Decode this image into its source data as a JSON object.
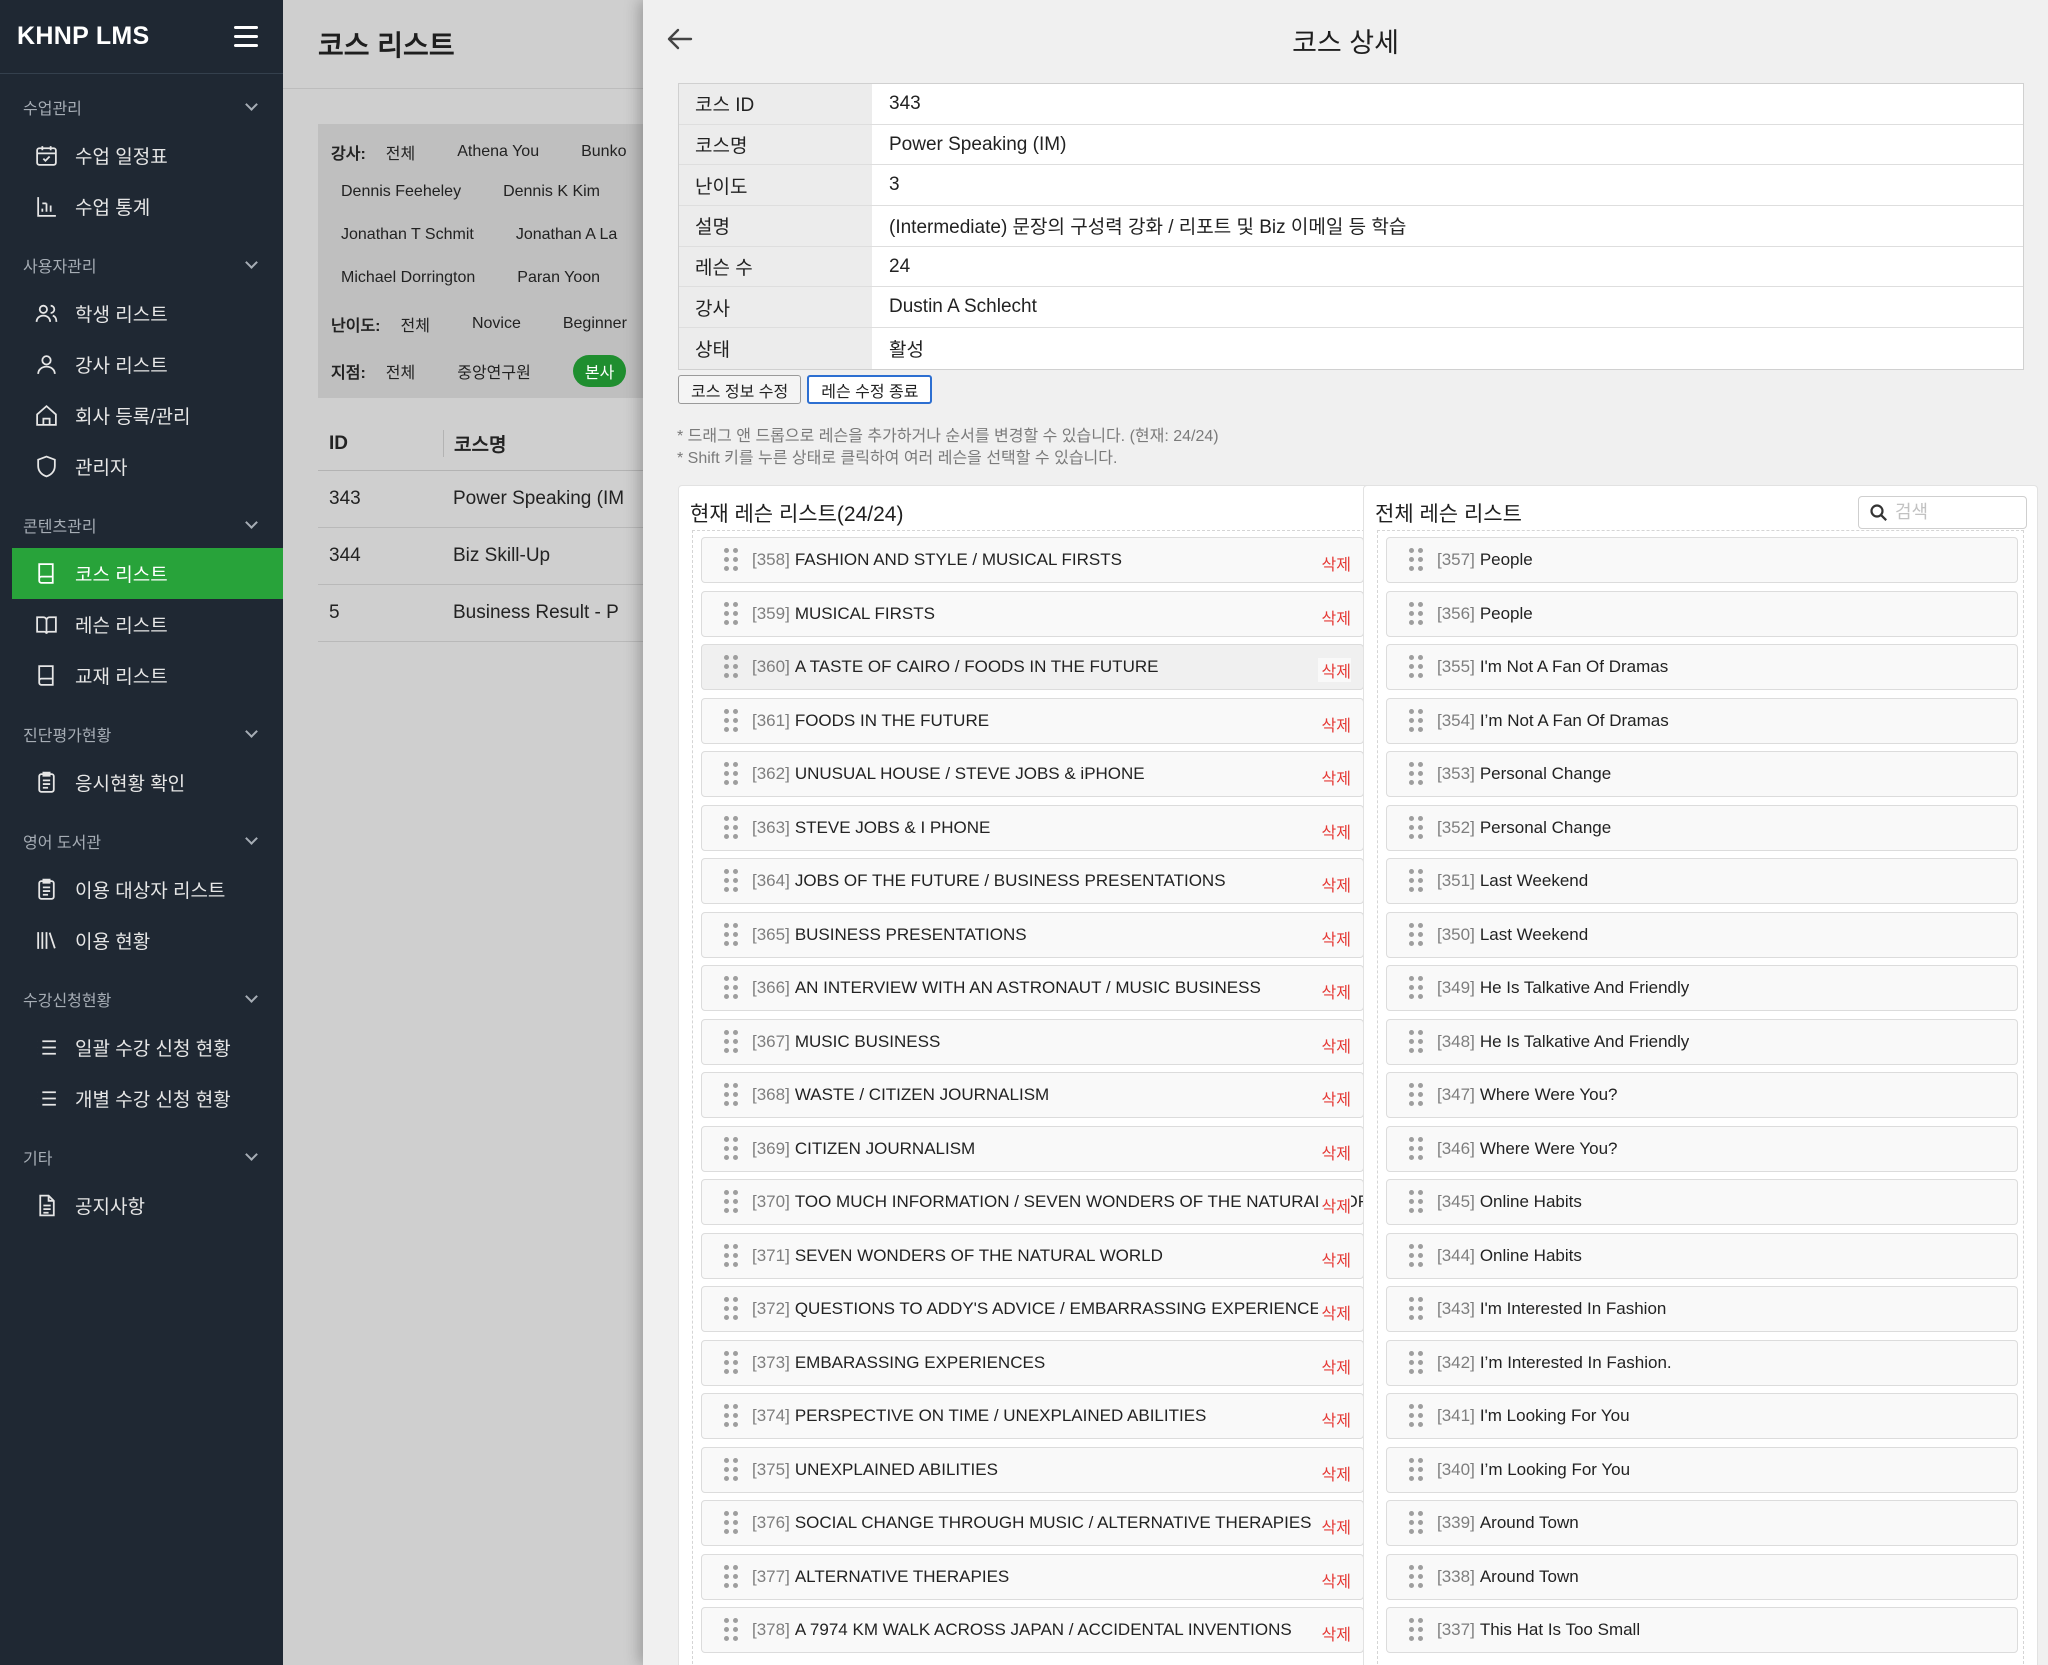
{
  "sidebar": {
    "brand": "KHNP LMS",
    "sections": [
      {
        "title": "수업관리",
        "items": [
          {
            "label": "수업 일정표",
            "icon": "calendar-check-icon"
          },
          {
            "label": "수업 통계",
            "icon": "chart-icon"
          }
        ]
      },
      {
        "title": "사용자관리",
        "items": [
          {
            "label": "학생 리스트",
            "icon": "users-icon"
          },
          {
            "label": "강사 리스트",
            "icon": "user-icon"
          },
          {
            "label": "회사 등록/관리",
            "icon": "home-icon"
          },
          {
            "label": "관리자",
            "icon": "shield-icon"
          }
        ]
      },
      {
        "title": "콘텐츠관리",
        "items": [
          {
            "label": "코스 리스트",
            "icon": "book-icon"
          },
          {
            "label": "레슨 리스트",
            "icon": "book-open-icon"
          },
          {
            "label": "교재 리스트",
            "icon": "book-icon"
          }
        ]
      },
      {
        "title": "진단평가현황",
        "items": [
          {
            "label": "응시현황 확인",
            "icon": "clipboard-icon"
          }
        ]
      },
      {
        "title": "영어 도서관",
        "items": [
          {
            "label": "이용 대상자 리스트",
            "icon": "clipboard-icon"
          },
          {
            "label": "이용 현황",
            "icon": "library-icon"
          }
        ]
      },
      {
        "title": "수강신청현황",
        "items": [
          {
            "label": "일괄 수강 신청 현황",
            "icon": "list-icon"
          },
          {
            "label": "개별 수강 신청 현황",
            "icon": "list-icon"
          }
        ]
      },
      {
        "title": "기타",
        "items": [
          {
            "label": "공지사항",
            "icon": "document-icon"
          }
        ]
      }
    ],
    "active_item": "코스 리스트"
  },
  "background": {
    "title": "코스 리스트",
    "filters": {
      "instructor_label": "강사:",
      "instructors_row1": [
        "전체",
        "Athena You",
        "Bunko"
      ],
      "instructors_row2": [
        "Dennis Feeheley",
        "Dennis K Kim"
      ],
      "instructors_row3": [
        "Jonathan T Schmit",
        "Jonathan A La"
      ],
      "instructors_row4": [
        "Michael Dorrington",
        "Paran Yoon"
      ],
      "level_label": "난이도:",
      "levels": [
        "전체",
        "Novice",
        "Beginner"
      ],
      "branch_label": "지점:",
      "branches": [
        "전체",
        "중앙연구원"
      ],
      "branch_selected": "본사"
    },
    "table": {
      "headers": [
        "ID",
        "코스명"
      ],
      "rows": [
        [
          "343",
          "Power Speaking (IM"
        ],
        [
          "344",
          "Biz Skill-Up"
        ],
        [
          "5",
          "Business Result - P"
        ]
      ]
    }
  },
  "drawer": {
    "title": "코스 상세",
    "info": [
      {
        "key": "코스 ID",
        "value": "343"
      },
      {
        "key": "코스명",
        "value": "Power Speaking (IM)"
      },
      {
        "key": "난이도",
        "value": "3"
      },
      {
        "key": "설명",
        "value": "(Intermediate) 문장의 구성력 강화 / 리포트 및 Biz 이메일 등 학습"
      },
      {
        "key": "레슨 수",
        "value": "24"
      },
      {
        "key": "강사",
        "value": "Dustin A Schlecht"
      },
      {
        "key": "상태",
        "value": "활성"
      }
    ],
    "buttons": {
      "edit_course": "코스 정보 수정",
      "finish_lesson_edit": "레슨 수정 종료"
    },
    "hints": [
      "* 드래그 앤 드롭으로 레슨을 추가하거나 순서를 변경할 수 있습니다. (현재: 24/24)",
      "* Shift 키를 누른 상태로 클릭하여 여러 레슨을 선택할 수 있습니다."
    ],
    "current_list": {
      "title": "현재 레슨 리스트(24/24)",
      "delete_label": "삭제",
      "items": [
        {
          "id": "[358]",
          "title": "FASHION AND STYLE / MUSICAL FIRSTS"
        },
        {
          "id": "[359]",
          "title": "MUSICAL FIRSTS"
        },
        {
          "id": "[360]",
          "title": "A TASTE OF CAIRO / FOODS IN THE FUTURE"
        },
        {
          "id": "[361]",
          "title": "FOODS IN THE FUTURE"
        },
        {
          "id": "[362]",
          "title": "UNUSUAL HOUSE / STEVE JOBS & iPHONE"
        },
        {
          "id": "[363]",
          "title": "STEVE JOBS & I PHONE"
        },
        {
          "id": "[364]",
          "title": "JOBS OF THE FUTURE / BUSINESS PRESENTATIONS"
        },
        {
          "id": "[365]",
          "title": "BUSINESS PRESENTATIONS"
        },
        {
          "id": "[366]",
          "title": "AN INTERVIEW WITH AN ASTRONAUT / MUSIC BUSINESS"
        },
        {
          "id": "[367]",
          "title": "MUSIC BUSINESS"
        },
        {
          "id": "[368]",
          "title": "WASTE / CITIZEN JOURNALISM"
        },
        {
          "id": "[369]",
          "title": "CITIZEN JOURNALISM"
        },
        {
          "id": "[370]",
          "title": "TOO MUCH INFORMATION / SEVEN WONDERS OF THE NATURAL WORLD"
        },
        {
          "id": "[371]",
          "title": "SEVEN WONDERS OF THE NATURAL WORLD"
        },
        {
          "id": "[372]",
          "title": "QUESTIONS TO ADDY'S ADVICE / EMBARRASSING EXPERIENCES"
        },
        {
          "id": "[373]",
          "title": "EMBARASSING EXPERIENCES"
        },
        {
          "id": "[374]",
          "title": "PERSPECTIVE ON TIME / UNEXPLAINED ABILITIES"
        },
        {
          "id": "[375]",
          "title": "UNEXPLAINED ABILITIES"
        },
        {
          "id": "[376]",
          "title": "SOCIAL CHANGE THROUGH MUSIC / ALTERNATIVE THERAPIES"
        },
        {
          "id": "[377]",
          "title": "ALTERNATIVE THERAPIES"
        },
        {
          "id": "[378]",
          "title": "A 7974 KM WALK ACROSS JAPAN / ACCIDENTAL INVENTIONS"
        }
      ]
    },
    "all_list": {
      "title": "전체 레슨 리스트",
      "search_placeholder": "검색",
      "items": [
        {
          "id": "[357]",
          "title": "People"
        },
        {
          "id": "[356]",
          "title": "People"
        },
        {
          "id": "[355]",
          "title": "I'm Not A Fan Of Dramas"
        },
        {
          "id": "[354]",
          "title": "I’m Not A Fan Of Dramas"
        },
        {
          "id": "[353]",
          "title": "Personal Change"
        },
        {
          "id": "[352]",
          "title": "Personal Change"
        },
        {
          "id": "[351]",
          "title": "Last Weekend"
        },
        {
          "id": "[350]",
          "title": "Last Weekend"
        },
        {
          "id": "[349]",
          "title": "He Is Talkative And Friendly"
        },
        {
          "id": "[348]",
          "title": "He Is Talkative And Friendly"
        },
        {
          "id": "[347]",
          "title": "Where Were You?"
        },
        {
          "id": "[346]",
          "title": "Where Were You?"
        },
        {
          "id": "[345]",
          "title": "Online Habits"
        },
        {
          "id": "[344]",
          "title": "Online Habits"
        },
        {
          "id": "[343]",
          "title": "I'm Interested In Fashion"
        },
        {
          "id": "[342]",
          "title": "I’m Interested In Fashion."
        },
        {
          "id": "[341]",
          "title": "I'm Looking For You"
        },
        {
          "id": "[340]",
          "title": "I’m Looking For You"
        },
        {
          "id": "[339]",
          "title": "Around Town"
        },
        {
          "id": "[338]",
          "title": "Around Town"
        },
        {
          "id": "[337]",
          "title": "This Hat Is Too Small"
        }
      ]
    }
  }
}
